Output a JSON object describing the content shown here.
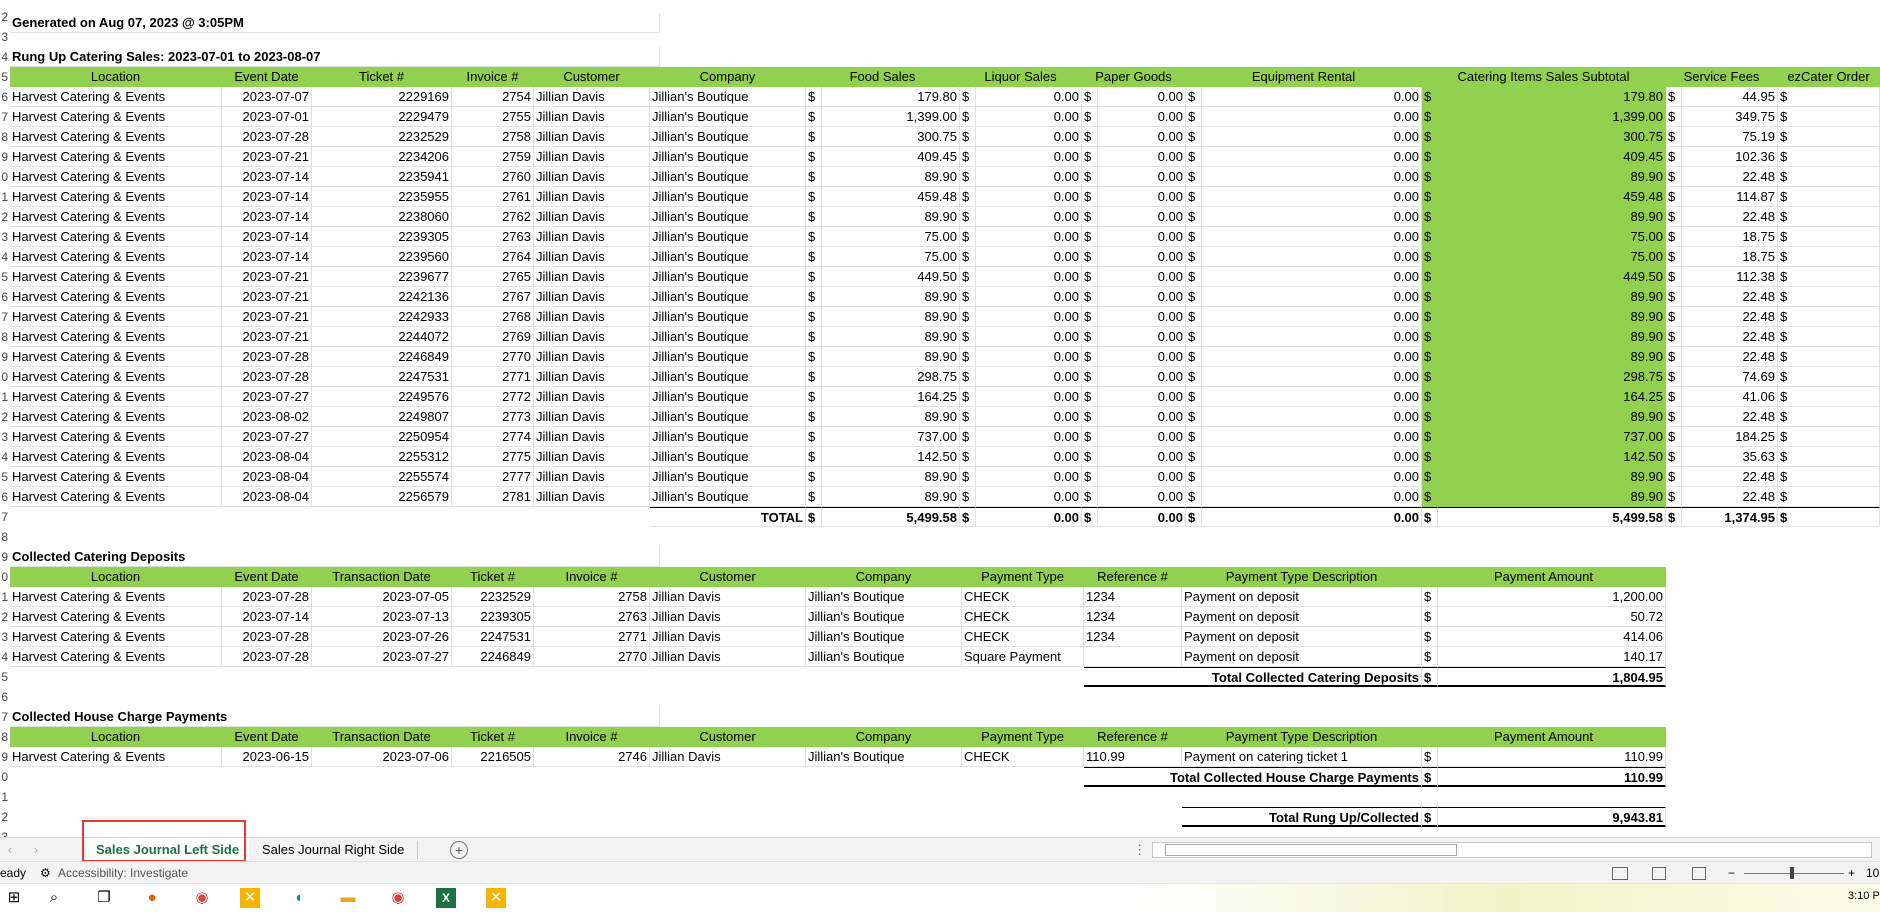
{
  "generated_text": "Generated on Aug 07, 2023 @ 3:05PM",
  "sections": {
    "rung_title": "Rung Up Catering Sales: 2023-07-01 to 2023-08-07",
    "rung_headers": [
      "Location",
      "Event Date",
      "Ticket #",
      "Invoice #",
      "Customer",
      "Company",
      "Food Sales",
      "Liquor Sales",
      "Paper Goods",
      "Equipment Rental",
      "Catering Items Sales Subtotal",
      "Service Fees",
      "ezCater Order"
    ],
    "rung_rows": [
      [
        "Harvest Catering & Events",
        "2023-07-07",
        "2229169",
        "2754",
        "Jillian Davis",
        "Jillian's Boutique",
        "179.80",
        "0.00",
        "0.00",
        "0.00",
        "179.80",
        "44.95"
      ],
      [
        "Harvest Catering & Events",
        "2023-07-01",
        "2229479",
        "2755",
        "Jillian Davis",
        "Jillian's Boutique",
        "1,399.00",
        "0.00",
        "0.00",
        "0.00",
        "1,399.00",
        "349.75"
      ],
      [
        "Harvest Catering & Events",
        "2023-07-28",
        "2232529",
        "2758",
        "Jillian Davis",
        "Jillian's Boutique",
        "300.75",
        "0.00",
        "0.00",
        "0.00",
        "300.75",
        "75.19"
      ],
      [
        "Harvest Catering & Events",
        "2023-07-21",
        "2234206",
        "2759",
        "Jillian Davis",
        "Jillian's Boutique",
        "409.45",
        "0.00",
        "0.00",
        "0.00",
        "409.45",
        "102.36"
      ],
      [
        "Harvest Catering & Events",
        "2023-07-14",
        "2235941",
        "2760",
        "Jillian Davis",
        "Jillian's Boutique",
        "89.90",
        "0.00",
        "0.00",
        "0.00",
        "89.90",
        "22.48"
      ],
      [
        "Harvest Catering & Events",
        "2023-07-14",
        "2235955",
        "2761",
        "Jillian Davis",
        "Jillian's Boutique",
        "459.48",
        "0.00",
        "0.00",
        "0.00",
        "459.48",
        "114.87"
      ],
      [
        "Harvest Catering & Events",
        "2023-07-14",
        "2238060",
        "2762",
        "Jillian Davis",
        "Jillian's Boutique",
        "89.90",
        "0.00",
        "0.00",
        "0.00",
        "89.90",
        "22.48"
      ],
      [
        "Harvest Catering & Events",
        "2023-07-14",
        "2239305",
        "2763",
        "Jillian Davis",
        "Jillian's Boutique",
        "75.00",
        "0.00",
        "0.00",
        "0.00",
        "75.00",
        "18.75"
      ],
      [
        "Harvest Catering & Events",
        "2023-07-14",
        "2239560",
        "2764",
        "Jillian Davis",
        "Jillian's Boutique",
        "75.00",
        "0.00",
        "0.00",
        "0.00",
        "75.00",
        "18.75"
      ],
      [
        "Harvest Catering & Events",
        "2023-07-21",
        "2239677",
        "2765",
        "Jillian Davis",
        "Jillian's Boutique",
        "449.50",
        "0.00",
        "0.00",
        "0.00",
        "449.50",
        "112.38"
      ],
      [
        "Harvest Catering & Events",
        "2023-07-21",
        "2242136",
        "2767",
        "Jillian Davis",
        "Jillian's Boutique",
        "89.90",
        "0.00",
        "0.00",
        "0.00",
        "89.90",
        "22.48"
      ],
      [
        "Harvest Catering & Events",
        "2023-07-21",
        "2242933",
        "2768",
        "Jillian Davis",
        "Jillian's Boutique",
        "89.90",
        "0.00",
        "0.00",
        "0.00",
        "89.90",
        "22.48"
      ],
      [
        "Harvest Catering & Events",
        "2023-07-21",
        "2244072",
        "2769",
        "Jillian Davis",
        "Jillian's Boutique",
        "89.90",
        "0.00",
        "0.00",
        "0.00",
        "89.90",
        "22.48"
      ],
      [
        "Harvest Catering & Events",
        "2023-07-28",
        "2246849",
        "2770",
        "Jillian Davis",
        "Jillian's Boutique",
        "89.90",
        "0.00",
        "0.00",
        "0.00",
        "89.90",
        "22.48"
      ],
      [
        "Harvest Catering & Events",
        "2023-07-28",
        "2247531",
        "2771",
        "Jillian Davis",
        "Jillian's Boutique",
        "298.75",
        "0.00",
        "0.00",
        "0.00",
        "298.75",
        "74.69"
      ],
      [
        "Harvest Catering & Events",
        "2023-07-27",
        "2249576",
        "2772",
        "Jillian Davis",
        "Jillian's Boutique",
        "164.25",
        "0.00",
        "0.00",
        "0.00",
        "164.25",
        "41.06"
      ],
      [
        "Harvest Catering & Events",
        "2023-08-02",
        "2249807",
        "2773",
        "Jillian Davis",
        "Jillian's Boutique",
        "89.90",
        "0.00",
        "0.00",
        "0.00",
        "89.90",
        "22.48"
      ],
      [
        "Harvest Catering & Events",
        "2023-07-27",
        "2250954",
        "2774",
        "Jillian Davis",
        "Jillian's Boutique",
        "737.00",
        "0.00",
        "0.00",
        "0.00",
        "737.00",
        "184.25"
      ],
      [
        "Harvest Catering & Events",
        "2023-08-04",
        "2255312",
        "2775",
        "Jillian Davis",
        "Jillian's Boutique",
        "142.50",
        "0.00",
        "0.00",
        "0.00",
        "142.50",
        "35.63"
      ],
      [
        "Harvest Catering & Events",
        "2023-08-04",
        "2255574",
        "2777",
        "Jillian Davis",
        "Jillian's Boutique",
        "89.90",
        "0.00",
        "0.00",
        "0.00",
        "89.90",
        "22.48"
      ],
      [
        "Harvest Catering & Events",
        "2023-08-04",
        "2256579",
        "2781",
        "Jillian Davis",
        "Jillian's Boutique",
        "89.90",
        "0.00",
        "0.00",
        "0.00",
        "89.90",
        "22.48"
      ]
    ],
    "rung_total_label": "TOTAL",
    "rung_totals": [
      "5,499.58",
      "0.00",
      "0.00",
      "0.00",
      "5,499.58",
      "1,374.95"
    ],
    "deposits_title": "Collected Catering Deposits",
    "pay_headers": [
      "Location",
      "Event Date",
      "Transaction Date",
      "Ticket #",
      "Invoice #",
      "Customer",
      "Company",
      "Payment Type",
      "Reference #",
      "Payment Type Description",
      "Payment Amount"
    ],
    "deposits_rows": [
      [
        "Harvest Catering & Events",
        "2023-07-28",
        "2023-07-05",
        "2232529",
        "2758",
        "Jillian Davis",
        "Jillian's Boutique",
        "CHECK",
        "1234",
        "Payment on deposit",
        "1,200.00"
      ],
      [
        "Harvest Catering & Events",
        "2023-07-14",
        "2023-07-13",
        "2239305",
        "2763",
        "Jillian Davis",
        "Jillian's Boutique",
        "CHECK",
        "1234",
        "Payment on deposit",
        "50.72"
      ],
      [
        "Harvest Catering & Events",
        "2023-07-28",
        "2023-07-26",
        "2247531",
        "2771",
        "Jillian Davis",
        "Jillian's Boutique",
        "CHECK",
        "1234",
        "Payment on deposit",
        "414.06"
      ],
      [
        "Harvest Catering & Events",
        "2023-07-28",
        "2023-07-27",
        "2246849",
        "2770",
        "Jillian Davis",
        "Jillian's Boutique",
        "Square Payment",
        "",
        "Payment on deposit",
        "140.17"
      ]
    ],
    "deposits_total_label": "Total Collected Catering Deposits",
    "deposits_total": "1,804.95",
    "house_title": "Collected House Charge Payments",
    "house_rows": [
      [
        "Harvest Catering & Events",
        "2023-06-15",
        "2023-07-06",
        "2216505",
        "2746",
        "Jillian Davis",
        "Jillian's Boutique",
        "CHECK",
        "110.99",
        "Payment on catering ticket 1",
        "110.99"
      ]
    ],
    "house_total_label": "Total Collected House Charge Payments",
    "house_total": "110.99",
    "grand_total_label": "Total Rung Up/Collected",
    "grand_total": "9,943.81",
    "currency": "$"
  },
  "tabs": [
    "Sales Journal Left Side",
    "Sales Journal Right Side"
  ],
  "status": {
    "ready": "eady",
    "accessibility": "Accessibility: Investigate",
    "zoom": "10"
  },
  "clock": "3:10 P",
  "colors": {
    "header_green": "#92d050",
    "active_tab": "#1e7145",
    "highlight": "#e53935"
  }
}
